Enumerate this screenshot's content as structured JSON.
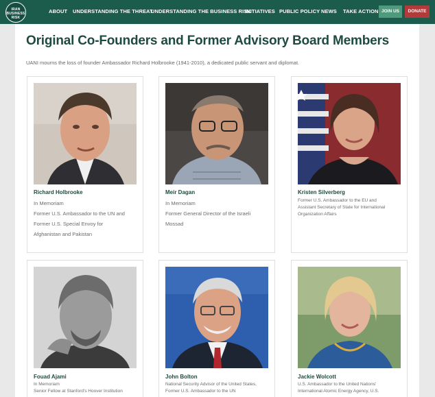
{
  "nav": {
    "logo": [
      "IRAN",
      "BUSINESS",
      "RISK"
    ],
    "items": [
      "ABOUT",
      "UNDERSTANDING THE THREAT",
      "UNDERSTANDING THE BUSINESS RISK",
      "INITIATIVES",
      "PUBLIC POLICY",
      "NEWS",
      "TAKE ACTION"
    ],
    "join": "JOIN US",
    "donate": "DONATE"
  },
  "page": {
    "title": "Original Co-Founders and Former Advisory Board Members",
    "intro": "UANI mourns the loss of founder Ambassador Richard Holbrooke (1941-2010), a dedicated public servant and diplomat."
  },
  "members": [
    {
      "name": "Richard Holbrooke",
      "lines": [
        "In Memoriam",
        "Former U.S. Ambassador to the UN and",
        "Former U.S. Special Envoy for",
        "Afghanistan and Pakistan"
      ]
    },
    {
      "name": "Meir Dagan",
      "lines": [
        "In Memoriam",
        "Former General Director of the Israeli",
        "Mossad"
      ]
    },
    {
      "name": "Kristen Silverberg",
      "lines": [
        "Former U.S. Ambassador to the EU and",
        "Assistant Secretary of State for International",
        "Organization Affairs"
      ]
    },
    {
      "name": "Fouad Ajami",
      "lines": [
        "In Memoriam",
        "Senior Fellow at Stanford's Hoover Institution"
      ]
    },
    {
      "name": "John Bolton",
      "lines": [
        "National Security Advisor of the United States,",
        "Former U.S. Ambassador to the UN"
      ]
    },
    {
      "name": "Jackie Wolcott",
      "lines": [
        "U.S. Ambassador to the United Nations'",
        "International Atomic Energy Agency, U.S."
      ]
    }
  ],
  "colors": {
    "nav_bg": "#1c5c4c",
    "title": "#1e4a40",
    "join": "#4f9a7d",
    "donate": "#b13a3a"
  }
}
